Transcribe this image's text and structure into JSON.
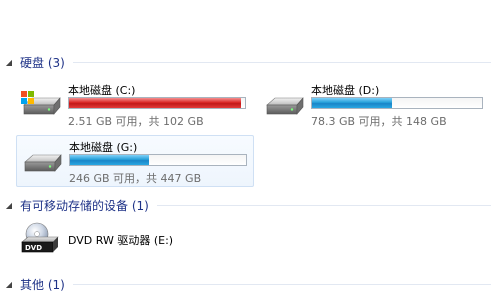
{
  "sections": {
    "hard_disks": {
      "title": "硬盘 (3)"
    },
    "removable": {
      "title": "有可移动存储的设备 (1)"
    },
    "other": {
      "title": "其他 (1)"
    }
  },
  "drives": [
    {
      "name": "本地磁盘 (C:)",
      "info": "2.51 GB 可用，共 102 GB",
      "used_fraction": 0.975,
      "bar_color": "red"
    },
    {
      "name": "本地磁盘 (D:)",
      "info": "78.3 GB 可用，共 148 GB",
      "used_fraction": 0.47,
      "bar_color": "blue"
    },
    {
      "name": "本地磁盘 (G:)",
      "info": "246 GB 可用，共 447 GB",
      "used_fraction": 0.45,
      "bar_color": "blue"
    }
  ],
  "removable_devices": [
    {
      "name": "DVD RW 驱动器 (E:)",
      "icon_label": "DVD"
    }
  ],
  "icons": {
    "hard_drive": "hard-drive-icon",
    "windows_drive": "windows-system-drive-icon",
    "dvd": "dvd-drive-icon",
    "caret": "expand-caret-icon"
  },
  "colors": {
    "section_title": "#1e3287",
    "bar_red": "#da2626",
    "bar_blue": "#26a0da",
    "info_text": "#6d6d6d"
  }
}
